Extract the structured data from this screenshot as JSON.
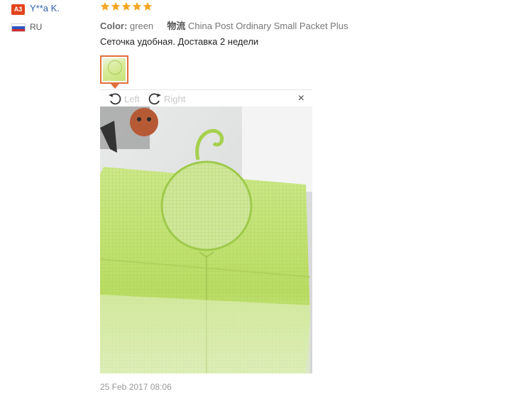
{
  "reviewer": {
    "badge": "A3",
    "name": "Y**a K.",
    "country": "RU",
    "flag_colors": [
      "#ffffff",
      "#2b56c5",
      "#d72b2b"
    ]
  },
  "review": {
    "stars": 5,
    "star_color": "#f5a623",
    "color_label": "Color:",
    "color_value": "green",
    "shipping_label": "物流",
    "shipping_value": "China Post Ordinary Small Packet Plus",
    "text": "Сеточка удобная. Доставка 2 недели",
    "date": "25 Feb 2017 08:06"
  },
  "viewer": {
    "rotate_left": "Left",
    "rotate_right": "Right",
    "close": "×",
    "accent_color": "#e36f3b"
  }
}
